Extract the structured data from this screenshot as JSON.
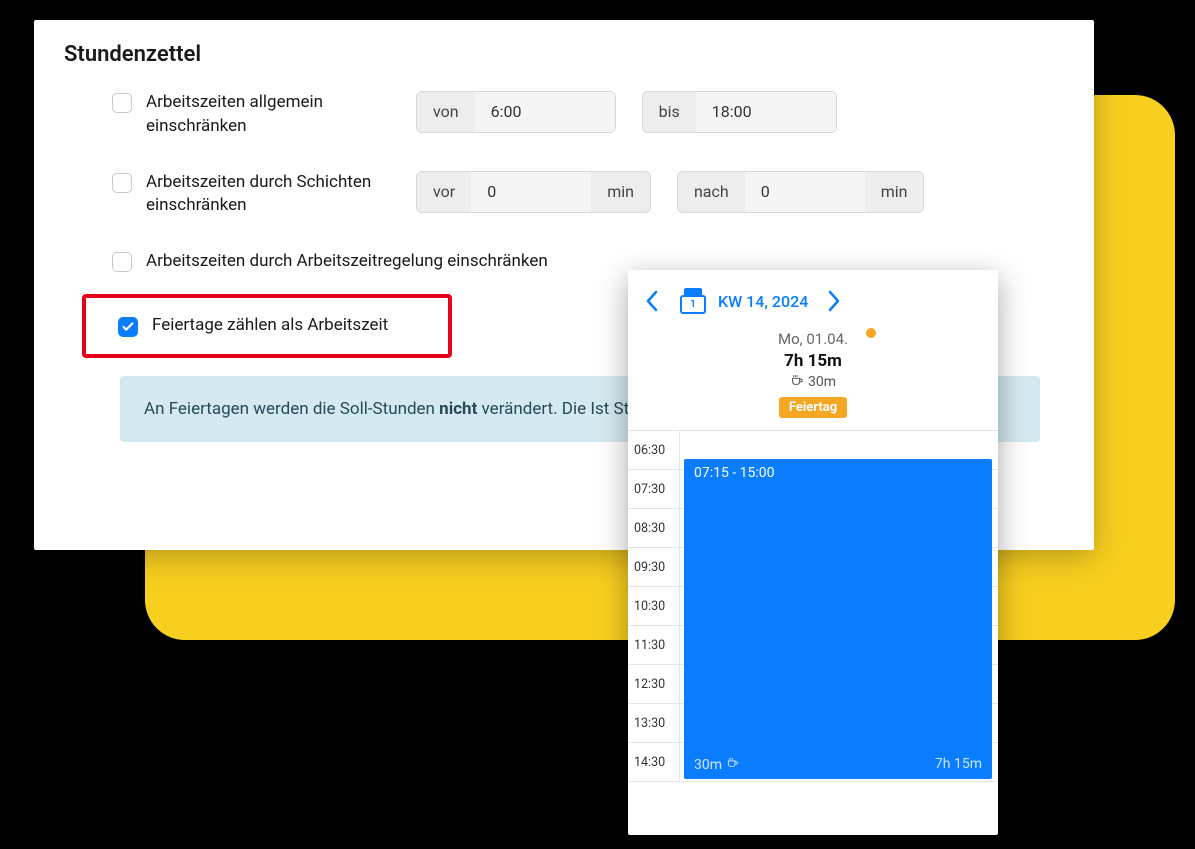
{
  "panel": {
    "title": "Stundenzettel",
    "rows": {
      "range": {
        "checked": false,
        "label": "Arbeitszeiten allgemein einschränken",
        "from_label": "von",
        "from_value": "6:00",
        "to_label": "bis",
        "to_value": "18:00"
      },
      "shifts": {
        "checked": false,
        "label": "Arbeitszeiten durch Schichten einschränken",
        "before_label": "vor",
        "before_value": "0",
        "before_unit": "min",
        "after_label": "nach",
        "after_value": "0",
        "after_unit": "min"
      },
      "regulation": {
        "checked": false,
        "label": "Arbeitszeiten durch Arbeitszeitregelung einschränken"
      },
      "holidays": {
        "checked": true,
        "label": "Feiertage zählen als Arbeitszeit"
      }
    },
    "info": {
      "pre": "An Feiertagen werden die Soll-Stunden ",
      "bold": "nicht",
      "post": " verändert. Die Ist Stunden gesetzt"
    }
  },
  "calendar": {
    "icon_day": "1",
    "week": "KW 14, 2024",
    "day_label": "Mo, 01.04.",
    "hours": "7h 15m",
    "break": "30m",
    "holiday_badge": "Feiertag",
    "times": [
      "06:30",
      "07:30",
      "08:30",
      "09:30",
      "10:30",
      "11:30",
      "12:30",
      "13:30",
      "14:30"
    ],
    "event": {
      "range": "07:15 - 15:00",
      "break": "30m",
      "duration": "7h 15m"
    }
  }
}
